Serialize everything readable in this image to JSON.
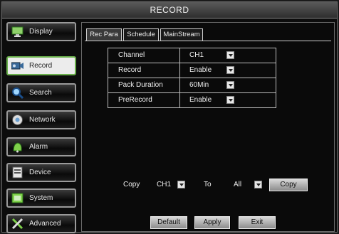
{
  "window": {
    "title": "RECORD"
  },
  "sidebar": {
    "items": [
      {
        "label": "Display",
        "icon": "monitor-icon"
      },
      {
        "label": "Record",
        "icon": "record-icon"
      },
      {
        "label": "Search",
        "icon": "search-icon"
      },
      {
        "label": "Network",
        "icon": "network-icon"
      },
      {
        "label": "Alarm",
        "icon": "alarm-icon"
      },
      {
        "label": "Device",
        "icon": "device-icon"
      },
      {
        "label": "System",
        "icon": "system-icon"
      },
      {
        "label": "Advanced",
        "icon": "advanced-icon"
      }
    ],
    "active": "Record"
  },
  "tabs": [
    {
      "label": "Rec Para",
      "active": true
    },
    {
      "label": "Schedule",
      "active": false
    },
    {
      "label": "MainStream",
      "active": false
    }
  ],
  "settings": {
    "channel": {
      "label": "Channel",
      "value": "CH1"
    },
    "record": {
      "label": "Record",
      "value": "Enable"
    },
    "pack_duration": {
      "label": "Pack Duration",
      "value": "60Min"
    },
    "prerecord": {
      "label": "PreRecord",
      "value": "Enable"
    }
  },
  "copy": {
    "label": "Copy",
    "from_value": "CH1",
    "to_label": "To",
    "to_value": "All",
    "button": "Copy"
  },
  "footer": {
    "default_label": "Default",
    "apply_label": "Apply",
    "exit_label": "Exit"
  },
  "colors": {
    "active_border": "#6ab04c",
    "panel_bg": "#0a0a0a",
    "text": "#eeeeee"
  }
}
